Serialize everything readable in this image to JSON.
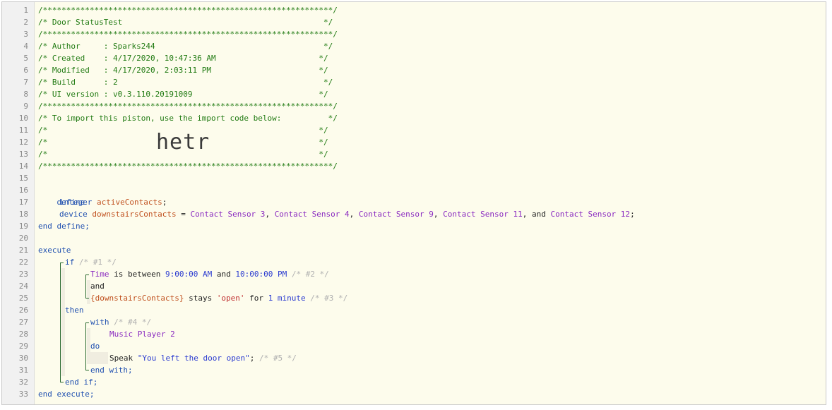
{
  "line_numbers": [
    "1",
    "2",
    "3",
    "4",
    "5",
    "6",
    "7",
    "8",
    "9",
    "10",
    "11",
    "12",
    "13",
    "14",
    "15",
    "16",
    "17",
    "18",
    "19",
    "20",
    "21",
    "22",
    "23",
    "24",
    "25",
    "26",
    "27",
    "28",
    "29",
    "30",
    "31",
    "32",
    "33"
  ],
  "header": {
    "border": "/**************************************************************/",
    "title": "/* Door StatusTest                                           */",
    "author": "/* Author     : Sparks244                                    */",
    "created": "/* Created    : 4/17/2020, 10:47:36 AM                      */",
    "modified": "/* Modified   : 4/17/2020, 2:03:11 PM                       */",
    "build": "/* Build      : 2                                            */",
    "ui_version": "/* UI version : v0.3.110.20191009                           */",
    "import_note": "/* To import this piston, use the import code below:          */",
    "empty_comment": "/*                                                          */",
    "import_code": "hetr"
  },
  "define": {
    "keyword": "define",
    "integer_kw": "integer",
    "active_contacts": "activeContacts",
    "semicolon": ";",
    "device_kw": "device",
    "downstairs_contacts": "downstairsContacts",
    "equals": " = ",
    "sensors": [
      "Contact Sensor 3",
      "Contact Sensor 4",
      "Contact Sensor 9",
      "Contact Sensor 11",
      "Contact Sensor 12"
    ],
    "comma": ", ",
    "and_text": ", and ",
    "end_define": "end define;"
  },
  "execute": {
    "keyword": "execute",
    "if_kw": "if",
    "c1": " /* #1 */",
    "time_kw": "Time",
    "is_between": " is between ",
    "time_start": "9:00:00 AM",
    "and_word": " and ",
    "time_end": "10:00:00 PM",
    "c2": " /* #2 */",
    "and_line": "and",
    "contacts_ref": "{downstairsContacts}",
    "stays": " stays ",
    "open_str": "'open'",
    "for_word": " for ",
    "one_minute": "1 minute",
    "c3": " /* #3 */",
    "then_kw": "then",
    "with_kw": "with",
    "c4": " /* #4 */",
    "music_player": "Music Player 2",
    "do_kw": "do",
    "speak": "Speak ",
    "speak_text": "\"You left the door open\"",
    "c5": " /* #5 */",
    "end_with": "end with;",
    "end_if": "end if;",
    "end_execute": "end execute;"
  }
}
